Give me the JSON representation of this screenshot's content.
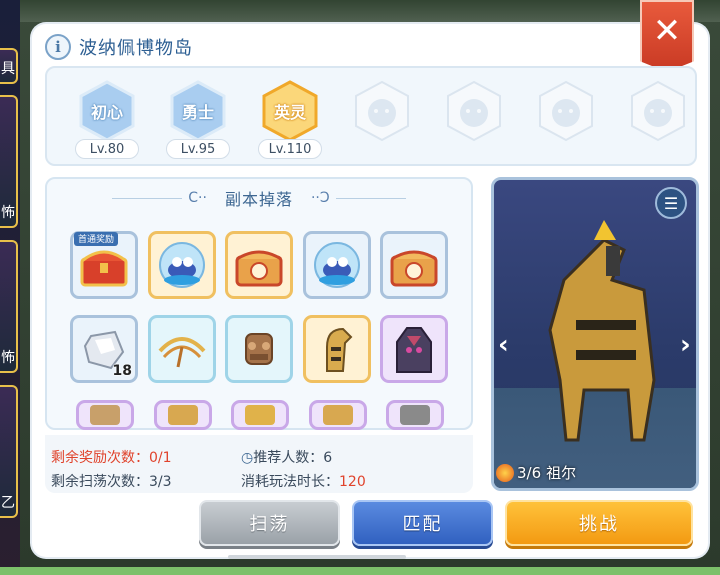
{
  "window": {
    "title": "波纳佩博物岛"
  },
  "left_cards": [
    {
      "label": "具"
    },
    {
      "label": "怖"
    },
    {
      "label": "怖"
    },
    {
      "label": "乙"
    }
  ],
  "difficulties": [
    {
      "name": "初心",
      "level": "Lv.80",
      "selected": false,
      "locked": false
    },
    {
      "name": "勇士",
      "level": "Lv.95",
      "selected": false,
      "locked": false
    },
    {
      "name": "英灵",
      "level": "Lv.110",
      "selected": true,
      "locked": false
    },
    {
      "name": "",
      "level": "",
      "selected": false,
      "locked": true
    },
    {
      "name": "",
      "level": "",
      "selected": false,
      "locked": true
    },
    {
      "name": "",
      "level": "",
      "selected": false,
      "locked": true
    },
    {
      "name": "",
      "level": "",
      "selected": false,
      "locked": true
    }
  ],
  "drops": {
    "header": "副本掉落",
    "first_clear_badge": "首通奖励",
    "items": [
      {
        "icon": "treasure-chest-icon",
        "frame": "blue"
      },
      {
        "icon": "orb-pet-icon",
        "frame": "gold"
      },
      {
        "icon": "clock-chest-icon",
        "frame": "gold"
      },
      {
        "icon": "orb-pet-icon",
        "frame": "blue"
      },
      {
        "icon": "clock-chest-icon",
        "frame": "blue"
      },
      {
        "icon": "crystal-ore-icon",
        "frame": "blue",
        "qty": "18"
      },
      {
        "icon": "golden-wings-icon",
        "frame": "cyan"
      },
      {
        "icon": "armor-piece-icon",
        "frame": "cyan"
      },
      {
        "icon": "golden-horse-icon",
        "frame": "gold"
      },
      {
        "icon": "dark-armor-icon",
        "frame": "purple"
      },
      {
        "icon": "equip-icon",
        "frame": "purple"
      },
      {
        "icon": "equip-icon",
        "frame": "purple"
      },
      {
        "icon": "equip-icon",
        "frame": "purple"
      },
      {
        "icon": "equip-icon",
        "frame": "purple"
      },
      {
        "icon": "equip-icon",
        "frame": "purple"
      }
    ]
  },
  "stats": {
    "reward_label": "剩余奖励次数：",
    "reward_value": "0/1",
    "recommend_label": "推荐人数：",
    "recommend_value": "6",
    "sweep_label": "剩余扫荡次数：",
    "sweep_value": "3/3",
    "cost_label": "消耗玩法时长：",
    "cost_value": "120"
  },
  "preview": {
    "progress": "3/6",
    "boss_name": "祖尔"
  },
  "buttons": {
    "sweep": "扫荡",
    "match": "匹配",
    "challenge": "挑战"
  },
  "colors": {
    "title": "#2d5f93",
    "accent_red": "#e0432c",
    "selected_gold": "#f0b43a"
  }
}
